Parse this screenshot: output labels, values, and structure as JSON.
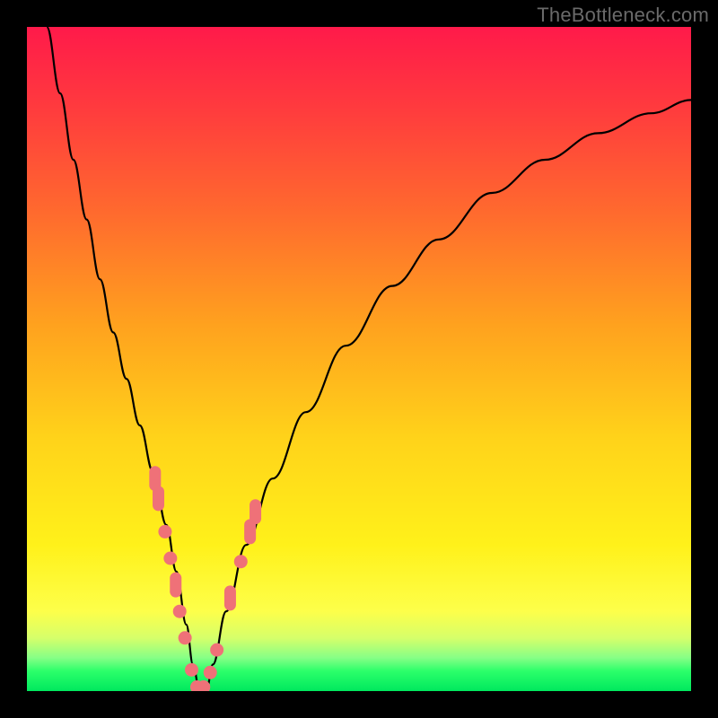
{
  "watermark": "TheBottleneck.com",
  "colors": {
    "background": "#000000",
    "gradient_top": "#ff1a4a",
    "gradient_bottom": "#00e85e",
    "curve": "#000000",
    "marker": "#ef7178"
  },
  "chart_data": {
    "type": "line",
    "title": "",
    "xlabel": "",
    "ylabel": "",
    "xlim": [
      0,
      100
    ],
    "ylim": [
      0,
      100
    ],
    "annotations": [
      "TheBottleneck.com"
    ],
    "series": [
      {
        "name": "bottleneck-curve",
        "x": [
          3,
          5,
          7,
          9,
          11,
          13,
          15,
          17,
          19,
          21,
          22.5,
          24,
          25,
          26,
          27,
          28,
          30,
          33,
          37,
          42,
          48,
          55,
          62,
          70,
          78,
          86,
          94,
          100
        ],
        "y": [
          100,
          90,
          80,
          71,
          62,
          54,
          47,
          40,
          33,
          25,
          18,
          10,
          4,
          0,
          0,
          4,
          12,
          22,
          32,
          42,
          52,
          61,
          68,
          75,
          80,
          84,
          87,
          89
        ]
      }
    ],
    "markers": [
      {
        "x": 19.3,
        "y": 32,
        "shape": "vcapsule"
      },
      {
        "x": 19.8,
        "y": 29,
        "shape": "vcapsule"
      },
      {
        "x": 20.8,
        "y": 24,
        "shape": "dot"
      },
      {
        "x": 21.6,
        "y": 20,
        "shape": "dot"
      },
      {
        "x": 22.4,
        "y": 16,
        "shape": "vcapsule"
      },
      {
        "x": 23.0,
        "y": 12,
        "shape": "dot"
      },
      {
        "x": 23.8,
        "y": 8,
        "shape": "dot"
      },
      {
        "x": 24.8,
        "y": 3.2,
        "shape": "dot"
      },
      {
        "x": 25.6,
        "y": 0.6,
        "shape": "dot"
      },
      {
        "x": 26.6,
        "y": 0.6,
        "shape": "dot"
      },
      {
        "x": 27.6,
        "y": 2.8,
        "shape": "dot"
      },
      {
        "x": 28.6,
        "y": 6.2,
        "shape": "dot"
      },
      {
        "x": 30.6,
        "y": 14,
        "shape": "vcapsule"
      },
      {
        "x": 32.2,
        "y": 19.5,
        "shape": "dot"
      },
      {
        "x": 33.6,
        "y": 24,
        "shape": "vcapsule"
      },
      {
        "x": 34.4,
        "y": 27,
        "shape": "vcapsule"
      }
    ]
  }
}
